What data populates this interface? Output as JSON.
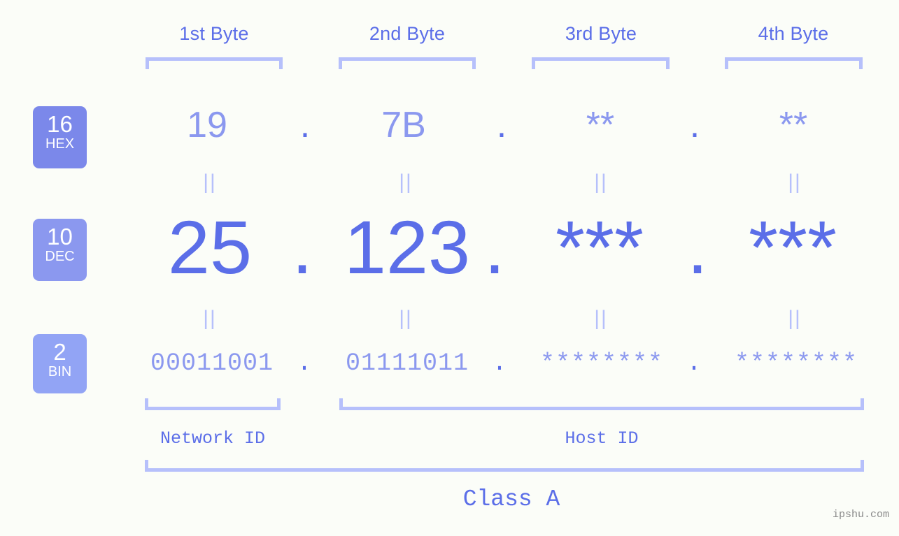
{
  "background_color": "#fbfdf8",
  "accent_color": "#5b6ee8",
  "accent_light": "#8b98ef",
  "accent_pale": "#b6c0fb",
  "columns": [
    {
      "header": "1st Byte"
    },
    {
      "header": "2nd Byte"
    },
    {
      "header": "3rd Byte"
    },
    {
      "header": "4th Byte"
    }
  ],
  "rows": {
    "hex": {
      "badge_base": "16",
      "badge_name": "HEX",
      "badge_color": "#7b88ea",
      "values": [
        "19",
        "7B",
        "**",
        "**"
      ],
      "separator": "."
    },
    "dec": {
      "badge_base": "10",
      "badge_name": "DEC",
      "badge_color": "#8b98ef",
      "values": [
        "25",
        "123",
        "***",
        "***"
      ],
      "separator": "."
    },
    "bin": {
      "badge_base": "2",
      "badge_name": "BIN",
      "badge_color": "#92a4f5",
      "values": [
        "00011001",
        "01111011",
        "********",
        "********"
      ],
      "separator": "."
    }
  },
  "equals_mark": "||",
  "sections": {
    "network_id": "Network ID",
    "host_id": "Host ID",
    "class": "Class A"
  },
  "watermark": "ipshu.com"
}
